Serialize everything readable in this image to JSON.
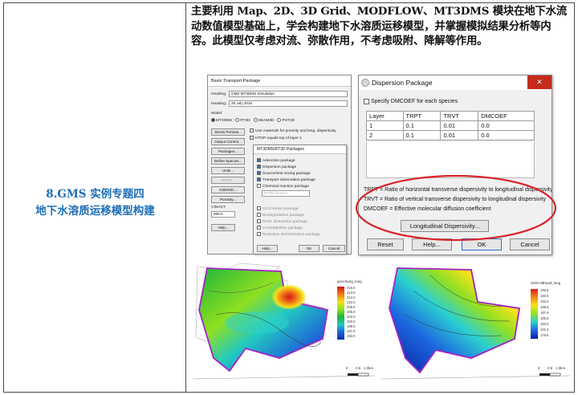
{
  "left_cell": {
    "line1": "8.GMS 实例专题四",
    "line2": "地下水溶质运移模型构建"
  },
  "paragraph": "主要利用 Map、2D、3D Grid、MODFLOW、MT3DMS 模块在地下水流动数值模型基础上，学会构建地下水溶质运移模型，并掌握模拟结果分析等内容。此模型仅考虑对流、弥散作用，不考虑吸附、降解等作用。",
  "basic_transport": {
    "title": "Basic Transport Package",
    "heading_label": "Heading:",
    "heading1": "GMS MT3DMS Simulation",
    "heading2": "28 July 2015",
    "model_label": "Model",
    "models": [
      "MT3DMS",
      "RT3D",
      "SEAM3D",
      "PHT3D"
    ],
    "buttons": [
      "Stress Periods...",
      "Output Control...",
      "Packages...",
      "Define Species...",
      "Units...",
      "HTOP...",
      "ICBUND...",
      "Porosity...",
      "Help..."
    ],
    "check1": "Use materials for porosity and long. dispersivity",
    "check2": "HTOP equals top of layer 1",
    "cinact_label": "CINACT",
    "cinact_value": "999.0",
    "ok": "OK",
    "cancel": "Cancel"
  },
  "packages": {
    "title": "MT3DMS/RT3D Packages",
    "items": [
      "Advection package",
      "Dispersion package",
      "Source/sink mixing package",
      "Transport observation package",
      "Chemical reaction package"
    ],
    "rt3d_label": "RT3D reaction",
    "items2": [
      "GCG solver package",
      "Biodegradation package",
      "NAPL dissolution package",
      "Cometabolism package",
      "Reductive dechlorination package"
    ],
    "help": "Help...",
    "ok": "OK",
    "cancel": "Cancel"
  },
  "dispersion": {
    "title": "Dispersion Package",
    "close": "✕",
    "specify": "Specify DMCOEF for each species",
    "columns": [
      "Layer",
      "TRPT",
      "TRVT",
      "DMCOEF"
    ],
    "rows": [
      [
        "1",
        "0.1",
        "0.01",
        "0.0"
      ],
      [
        "2",
        "0.1",
        "0.01",
        "0.0"
      ]
    ],
    "desc1": "TRPT = Ratio of horizontal transverse dispersivity to longitudinal dispersivity",
    "desc2": "TRVT = Ratio of vertical transverse dispersivity to longitudinal dispersivity",
    "desc3": "DMCOEF = Effective molecular diffusion coefficient",
    "long_btn": "Longitudinal Dispersivity...",
    "reset": "Reset",
    "help": "Help...",
    "ok": "OK",
    "cancel": "Cancel"
  },
  "map1": {
    "legend_title": "gunchang_long",
    "legend_values": [
      "215.0",
      "213.0",
      "212.0",
      "210.0",
      "209.0",
      "205.0",
      "202.0",
      "200.0",
      "199.0",
      "197.0",
      "193.0"
    ],
    "scale": [
      "0",
      "0.5",
      "1.0km"
    ]
  },
  "map2": {
    "legend_title": "2020.08head_long",
    "legend_values": [
      "195.5",
      "193.5",
      "193.0",
      "189.5",
      "187.5",
      "185.5",
      "183.5",
      "181.5",
      "179.5"
    ],
    "scale": [
      "0",
      "0.5",
      "1.0km"
    ]
  },
  "colors": {
    "blue_label": "#1f6fb8",
    "red_ellipse": "#d9232a",
    "close_red": "#c42b1c"
  }
}
